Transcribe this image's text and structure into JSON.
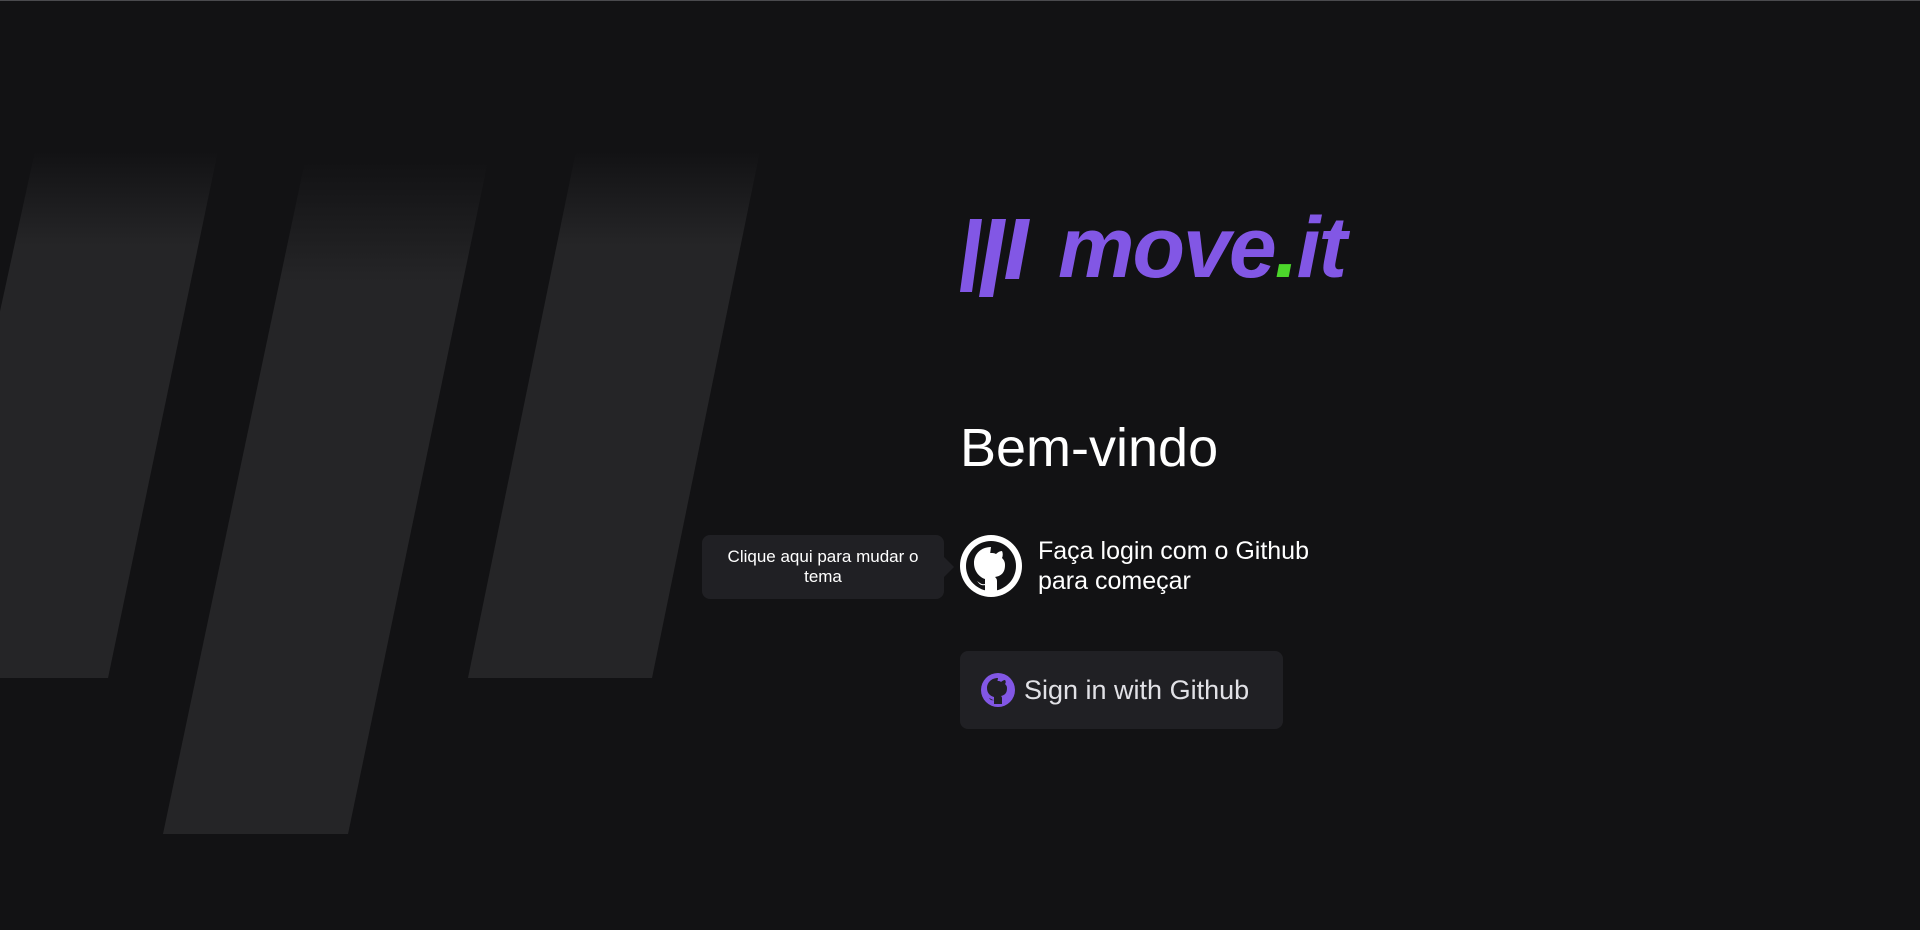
{
  "logo": {
    "icon": "bars-logo-icon",
    "word_primary": "move",
    "word_dot": ".",
    "word_suffix": "it"
  },
  "heading": "Bem-vindo",
  "login_prompt": {
    "icon": "github-icon",
    "text": "Faça login com o Github para começar"
  },
  "signin_button": {
    "icon": "github-icon",
    "label": "Sign in with Github"
  },
  "theme_tooltip": {
    "text": "Clique aqui para mudar o tema"
  },
  "colors": {
    "background": "#121214",
    "panel": "#202024",
    "stripe": "#252527",
    "brand_purple": "#8257e5",
    "brand_green": "#4cd62b",
    "text": "#ffffff"
  }
}
